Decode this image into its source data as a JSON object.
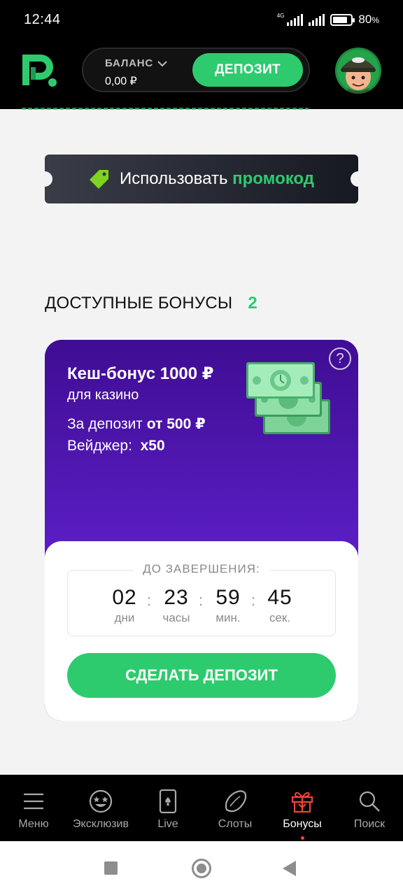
{
  "status_bar": {
    "time": "12:44",
    "network": "4G",
    "battery": "80",
    "battery_unit": "%",
    "battery_level": 0.8
  },
  "header": {
    "balance_label": "БАЛАНС",
    "balance_value": "0,00 ₽",
    "deposit_label": "ДЕПОЗИТ"
  },
  "promo": {
    "text": "Использовать",
    "highlight": "промокод"
  },
  "bonuses": {
    "title": "ДОСТУПНЫЕ БОНУСЫ",
    "count": "2"
  },
  "bonus_card": {
    "help": "?",
    "title": "Кеш-бонус 1000 ₽",
    "subtitle": "для казино",
    "deposit_prefix": "За депозит",
    "deposit_value": "от 500 ₽",
    "wager_prefix": "Вейджер:",
    "wager_value": "x50",
    "timer_label": "ДО ЗАВЕРШЕНИЯ:",
    "timer": [
      {
        "value": "02",
        "unit": "дни"
      },
      {
        "value": "23",
        "unit": "часы"
      },
      {
        "value": "59",
        "unit": "мин."
      },
      {
        "value": "45",
        "unit": "сек."
      }
    ],
    "timer_sep": ":",
    "action_label": "СДЕЛАТЬ ДЕПОЗИТ"
  },
  "bottom_nav": [
    {
      "label": "Меню",
      "icon": "menu-icon"
    },
    {
      "label": "Эксклюзив",
      "icon": "star-eyes-icon"
    },
    {
      "label": "Live",
      "icon": "card-icon"
    },
    {
      "label": "Слоты",
      "icon": "lemon-icon"
    },
    {
      "label": "Бонусы",
      "icon": "gift-icon",
      "active": true
    },
    {
      "label": "Поиск",
      "icon": "search-icon"
    }
  ],
  "colors": {
    "accent": "#2dcb6e",
    "card_purple": "#5d1fc9",
    "active_nav": "#f44336"
  }
}
